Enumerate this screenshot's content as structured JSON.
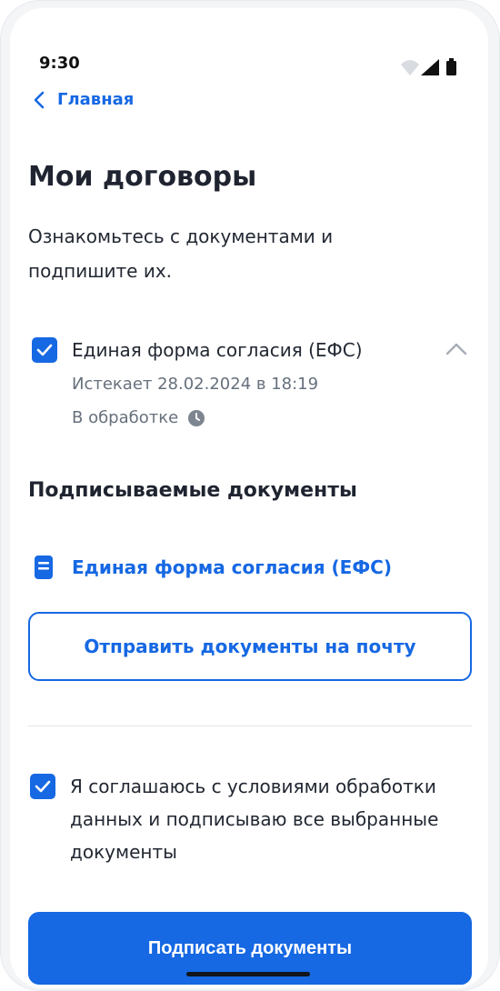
{
  "status_bar": {
    "time": "9:30",
    "icons": [
      "wifi-icon",
      "signal-icon",
      "battery-icon"
    ]
  },
  "nav": {
    "back_label": "Главная",
    "back_icon": "chevron-left-icon"
  },
  "page": {
    "title": "Мои договоры",
    "intro": "Ознакомьтесь с документами и подпишите их."
  },
  "document": {
    "checked": true,
    "title": "Единая форма согласия (ЕФС)",
    "expires": "Истекает 28.02.2024 в 18:19",
    "status": "В обработке",
    "status_icon": "clock-icon",
    "expand_icon": "chevron-up-icon"
  },
  "signing_section": {
    "title": "Подписываемые документы",
    "doc_link_label": "Единая форма согласия (ЕФС)",
    "doc_icon": "document-icon",
    "send_button_label": "Отправить документы на почту"
  },
  "consent": {
    "checked": true,
    "text": "Я соглашаюсь с условиями обработки данных и подписываю все выбранные документы"
  },
  "actions": {
    "sign_button_label": "Подписать документы"
  },
  "colors": {
    "accent": "#1668e3",
    "text": "#222832",
    "muted": "#66707c",
    "divider": "#e3e6ea"
  }
}
